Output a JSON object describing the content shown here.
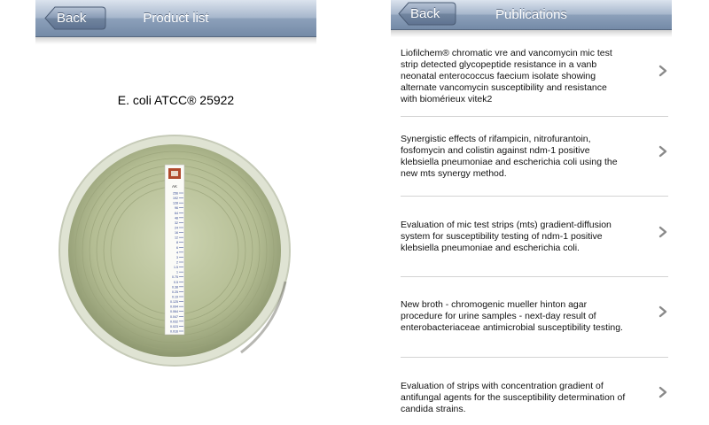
{
  "product_screen": {
    "back_label": "Back",
    "title": "Product list",
    "plate_title": "E. coli ATCC® 25922",
    "strip_code": "AK",
    "strip_scale": [
      "256",
      "192",
      "128",
      "96",
      "64",
      "48",
      "32",
      "24",
      "16",
      "12",
      "8",
      "6",
      "4",
      "3",
      "2",
      "1.5",
      "1",
      "0.75",
      "0.5",
      "0.38",
      "0.25",
      "0.19",
      "0.125",
      "0.094",
      "0.064",
      "0.047",
      "0.032",
      "0.023",
      "0.016"
    ]
  },
  "publications_screen": {
    "back_label": "Back",
    "title": "Publications",
    "items": [
      {
        "line1": "Liofilchem® chromatic vre and vancomycin mic test",
        "line2": "strip detected glycopeptide resistance in a vanb",
        "line3": "neonatal enterococcus faecium isolate showing",
        "line4": "alternate vancomycin susceptibility and resistance",
        "line5": "with biomérieux vitek2"
      },
      {
        "line1": "Synergistic effects of rifampicin, nitrofurantoin,",
        "line2": "fosfomycin and colistin against ndm-1 positive",
        "line3": "klebsiella pneumoniae and escherichia coli using the",
        "line4": "new mts synergy method.",
        "line5": ""
      },
      {
        "line1": "Evaluation of mic test strips (mts) gradient-diffusion",
        "line2": "system for susceptibility testing of ndm-1 positive",
        "line3": "klebsiella pneumoniae and escherichia coli.",
        "line4": "",
        "line5": ""
      },
      {
        "line1": "New broth - chromogenic mueller hinton agar",
        "line2": "procedure for urine samples - next-day result of",
        "line3": "enterobacteriaceae antimicrobial susceptibility testing.",
        "line4": "",
        "line5": ""
      },
      {
        "line1": "Evaluation of strips with concentration gradient of",
        "line2": "antifungal agents for the susceptibility determination of",
        "line3": "candida strains.",
        "line4": "",
        "line5": ""
      }
    ]
  },
  "colors": {
    "navbar_top": "#dbe3ee",
    "navbar_bottom": "#748aa7",
    "agar": "#b8c19a",
    "chevron": "#8a8a8a"
  },
  "icons": {
    "back": "back-arrow-button",
    "row": "chevron-right-icon",
    "logo": "liofilchem-logo"
  }
}
